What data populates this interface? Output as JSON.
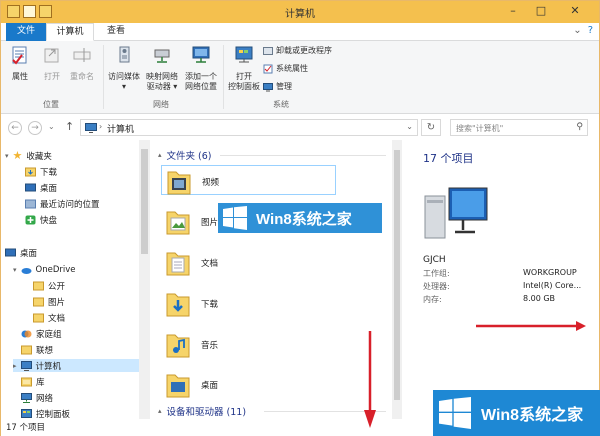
{
  "window": {
    "title": "计算机"
  },
  "tabs": {
    "file": "文件",
    "computer": "计算机",
    "view": "查看"
  },
  "ribbon": {
    "location": {
      "properties": "属性",
      "open": "打开",
      "rename": "重命名",
      "group_label": "位置"
    },
    "network": {
      "access_media_l1": "访问媒体",
      "map_drive_l1": "映射网络",
      "map_drive_l2": "驱动器",
      "add_location_l1": "添加一个",
      "add_location_l2": "网络位置",
      "group_label": "网络"
    },
    "system": {
      "open_cp_l1": "打开",
      "open_cp_l2": "控制面板",
      "uninstall": "卸载或更改程序",
      "sys_props": "系统属性",
      "manage": "管理",
      "group_label": "系统"
    }
  },
  "address": {
    "path": "计算机",
    "search_placeholder": "搜索\"计算机\""
  },
  "nav": {
    "favorites": "收藏夹",
    "downloads": "下载",
    "desktop": "桌面",
    "recent": "最近访问的位置",
    "kuaipan": "快盘",
    "desktop_root": "桌面",
    "onedrive": "OneDrive",
    "public": "公开",
    "pictures": "图片",
    "documents": "文档",
    "homegroup": "家庭组",
    "lenovo": "联想",
    "computer": "计算机",
    "libraries": "库",
    "network": "网络",
    "control_panel": "控制面板"
  },
  "main": {
    "folders_header": "文件夹 (6)",
    "folders": [
      "视频",
      "图片",
      "文档",
      "下载",
      "音乐",
      "桌面"
    ],
    "devices_header": "设备和驱动器 (11)"
  },
  "details": {
    "count": "17 个项目",
    "computer_name": "GJCH",
    "workgroup_label": "工作组:",
    "workgroup_value": "WORKGROUP",
    "processor_label": "处理器:",
    "processor_value": "Intel(R) Core...",
    "memory_label": "内存:",
    "memory_value": "8.00 GB"
  },
  "status": {
    "items": "17 个项目"
  },
  "watermark": {
    "text": "Win8系统之家"
  },
  "colors": {
    "titlebar": "#f4c04e",
    "accent": "#1979ca",
    "arrow": "#d8202a"
  }
}
